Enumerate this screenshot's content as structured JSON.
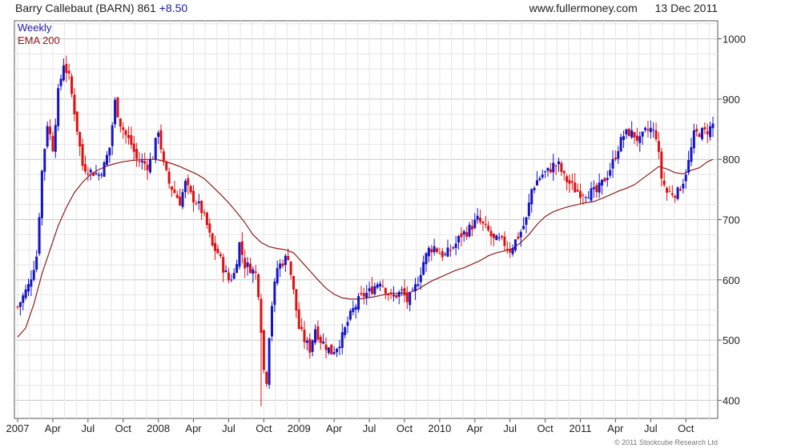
{
  "header": {
    "title": "Barry Callebaut (BARN) 861",
    "change": "+8.50",
    "site": "www.fullermoney.com",
    "date": "13 Dec 2011"
  },
  "legend": {
    "weekly": "Weekly",
    "ema": "EMA 200"
  },
  "credit": "© 2011 Stockcube Research Ltd",
  "colors": {
    "up": "#1414c8",
    "down": "#e01010",
    "ema": "#8b2020",
    "grid": "#d4d4d4",
    "axis": "#555555"
  },
  "chart_data": {
    "type": "candlestick",
    "ylim": [
      370,
      1030
    ],
    "yticks": [
      400,
      500,
      600,
      700,
      800,
      900,
      1000
    ],
    "x_range_weeks": [
      0,
      257
    ],
    "xtick_labels": [
      "2007",
      "Apr",
      "Jul",
      "Oct",
      "2008",
      "Apr",
      "Jul",
      "Oct",
      "2009",
      "Apr",
      "Jul",
      "Oct",
      "2010",
      "Apr",
      "Jul",
      "Oct",
      "2011",
      "Apr",
      "Jul",
      "Oct"
    ],
    "xtick_weeks": [
      0,
      13,
      26,
      39,
      52,
      65,
      78,
      91,
      104,
      117,
      130,
      143,
      156,
      169,
      182,
      195,
      208,
      221,
      234,
      247
    ],
    "price_anchors": [
      [
        0,
        555
      ],
      [
        4,
        590
      ],
      [
        7,
        640
      ],
      [
        9,
        780
      ],
      [
        11,
        860
      ],
      [
        13,
        820
      ],
      [
        15,
        910
      ],
      [
        17,
        960
      ],
      [
        19,
        935
      ],
      [
        21,
        880
      ],
      [
        24,
        790
      ],
      [
        27,
        780
      ],
      [
        30,
        775
      ],
      [
        32,
        790
      ],
      [
        34,
        820
      ],
      [
        36,
        895
      ],
      [
        38,
        860
      ],
      [
        40,
        840
      ],
      [
        42,
        825
      ],
      [
        44,
        800
      ],
      [
        46,
        795
      ],
      [
        48,
        790
      ],
      [
        50,
        805
      ],
      [
        52,
        850
      ],
      [
        54,
        790
      ],
      [
        56,
        760
      ],
      [
        58,
        745
      ],
      [
        60,
        730
      ],
      [
        62,
        760
      ],
      [
        64,
        740
      ],
      [
        66,
        730
      ],
      [
        68,
        715
      ],
      [
        70,
        690
      ],
      [
        72,
        655
      ],
      [
        74,
        645
      ],
      [
        76,
        620
      ],
      [
        78,
        600
      ],
      [
        80,
        610
      ],
      [
        82,
        660
      ],
      [
        84,
        625
      ],
      [
        86,
        620
      ],
      [
        88,
        610
      ],
      [
        89,
        580
      ],
      [
        90,
        520
      ],
      [
        91,
        450
      ],
      [
        92,
        435
      ],
      [
        93,
        510
      ],
      [
        94,
        560
      ],
      [
        96,
        620
      ],
      [
        98,
        630
      ],
      [
        100,
        640
      ],
      [
        102,
        580
      ],
      [
        104,
        520
      ],
      [
        106,
        500
      ],
      [
        108,
        485
      ],
      [
        110,
        520
      ],
      [
        112,
        500
      ],
      [
        114,
        490
      ],
      [
        116,
        480
      ],
      [
        118,
        490
      ],
      [
        120,
        505
      ],
      [
        122,
        530
      ],
      [
        124,
        550
      ],
      [
        126,
        565
      ],
      [
        128,
        575
      ],
      [
        130,
        580
      ],
      [
        132,
        590
      ],
      [
        134,
        600
      ],
      [
        136,
        585
      ],
      [
        138,
        570
      ],
      [
        140,
        575
      ],
      [
        142,
        580
      ],
      [
        144,
        565
      ],
      [
        146,
        575
      ],
      [
        148,
        600
      ],
      [
        150,
        630
      ],
      [
        152,
        650
      ],
      [
        154,
        655
      ],
      [
        156,
        645
      ],
      [
        158,
        640
      ],
      [
        160,
        650
      ],
      [
        162,
        660
      ],
      [
        164,
        675
      ],
      [
        166,
        680
      ],
      [
        168,
        690
      ],
      [
        170,
        700
      ],
      [
        172,
        690
      ],
      [
        174,
        680
      ],
      [
        176,
        665
      ],
      [
        178,
        665
      ],
      [
        180,
        660
      ],
      [
        182,
        650
      ],
      [
        184,
        665
      ],
      [
        186,
        680
      ],
      [
        188,
        700
      ],
      [
        190,
        750
      ],
      [
        192,
        765
      ],
      [
        194,
        775
      ],
      [
        196,
        780
      ],
      [
        198,
        790
      ],
      [
        200,
        790
      ],
      [
        202,
        770
      ],
      [
        204,
        760
      ],
      [
        206,
        750
      ],
      [
        208,
        745
      ],
      [
        210,
        745
      ],
      [
        212,
        745
      ],
      [
        214,
        745
      ],
      [
        216,
        760
      ],
      [
        218,
        775
      ],
      [
        220,
        795
      ],
      [
        222,
        820
      ],
      [
        224,
        840
      ],
      [
        226,
        845
      ],
      [
        228,
        840
      ],
      [
        230,
        830
      ],
      [
        232,
        845
      ],
      [
        234,
        850
      ],
      [
        236,
        840
      ],
      [
        238,
        770
      ],
      [
        240,
        745
      ],
      [
        242,
        745
      ],
      [
        244,
        745
      ],
      [
        246,
        765
      ],
      [
        248,
        795
      ],
      [
        250,
        840
      ],
      [
        252,
        845
      ],
      [
        254,
        845
      ],
      [
        256,
        852
      ],
      [
        257,
        858
      ]
    ],
    "ema": {
      "name": "EMA 200",
      "points": [
        [
          0,
          505
        ],
        [
          3,
          520
        ],
        [
          6,
          560
        ],
        [
          9,
          610
        ],
        [
          12,
          650
        ],
        [
          15,
          690
        ],
        [
          18,
          720
        ],
        [
          21,
          745
        ],
        [
          24,
          762
        ],
        [
          27,
          775
        ],
        [
          30,
          783
        ],
        [
          33,
          789
        ],
        [
          36,
          793
        ],
        [
          39,
          796
        ],
        [
          42,
          798
        ],
        [
          45,
          799
        ],
        [
          48,
          800
        ],
        [
          51,
          800
        ],
        [
          54,
          797
        ],
        [
          57,
          793
        ],
        [
          60,
          788
        ],
        [
          63,
          782
        ],
        [
          66,
          776
        ],
        [
          69,
          768
        ],
        [
          72,
          755
        ],
        [
          75,
          742
        ],
        [
          78,
          728
        ],
        [
          81,
          712
        ],
        [
          84,
          695
        ],
        [
          87,
          675
        ],
        [
          90,
          662
        ],
        [
          93,
          655
        ],
        [
          96,
          652
        ],
        [
          99,
          650
        ],
        [
          102,
          645
        ],
        [
          105,
          630
        ],
        [
          108,
          615
        ],
        [
          111,
          600
        ],
        [
          114,
          586
        ],
        [
          117,
          576
        ],
        [
          120,
          570
        ],
        [
          123,
          568
        ],
        [
          126,
          568
        ],
        [
          129,
          570
        ],
        [
          132,
          572
        ],
        [
          135,
          575
        ],
        [
          138,
          577
        ],
        [
          141,
          578
        ],
        [
          144,
          578
        ],
        [
          147,
          582
        ],
        [
          150,
          590
        ],
        [
          153,
          598
        ],
        [
          156,
          604
        ],
        [
          159,
          610
        ],
        [
          162,
          616
        ],
        [
          165,
          620
        ],
        [
          168,
          626
        ],
        [
          171,
          632
        ],
        [
          174,
          640
        ],
        [
          177,
          645
        ],
        [
          180,
          648
        ],
        [
          183,
          652
        ],
        [
          186,
          662
        ],
        [
          189,
          675
        ],
        [
          192,
          692
        ],
        [
          195,
          705
        ],
        [
          198,
          713
        ],
        [
          201,
          718
        ],
        [
          204,
          722
        ],
        [
          207,
          725
        ],
        [
          210,
          728
        ],
        [
          213,
          730
        ],
        [
          216,
          735
        ],
        [
          219,
          741
        ],
        [
          222,
          747
        ],
        [
          225,
          752
        ],
        [
          228,
          758
        ],
        [
          231,
          768
        ],
        [
          234,
          778
        ],
        [
          237,
          788
        ],
        [
          240,
          784
        ],
        [
          243,
          778
        ],
        [
          246,
          776
        ],
        [
          249,
          782
        ],
        [
          252,
          786
        ],
        [
          255,
          796
        ],
        [
          257,
          800
        ]
      ]
    }
  }
}
